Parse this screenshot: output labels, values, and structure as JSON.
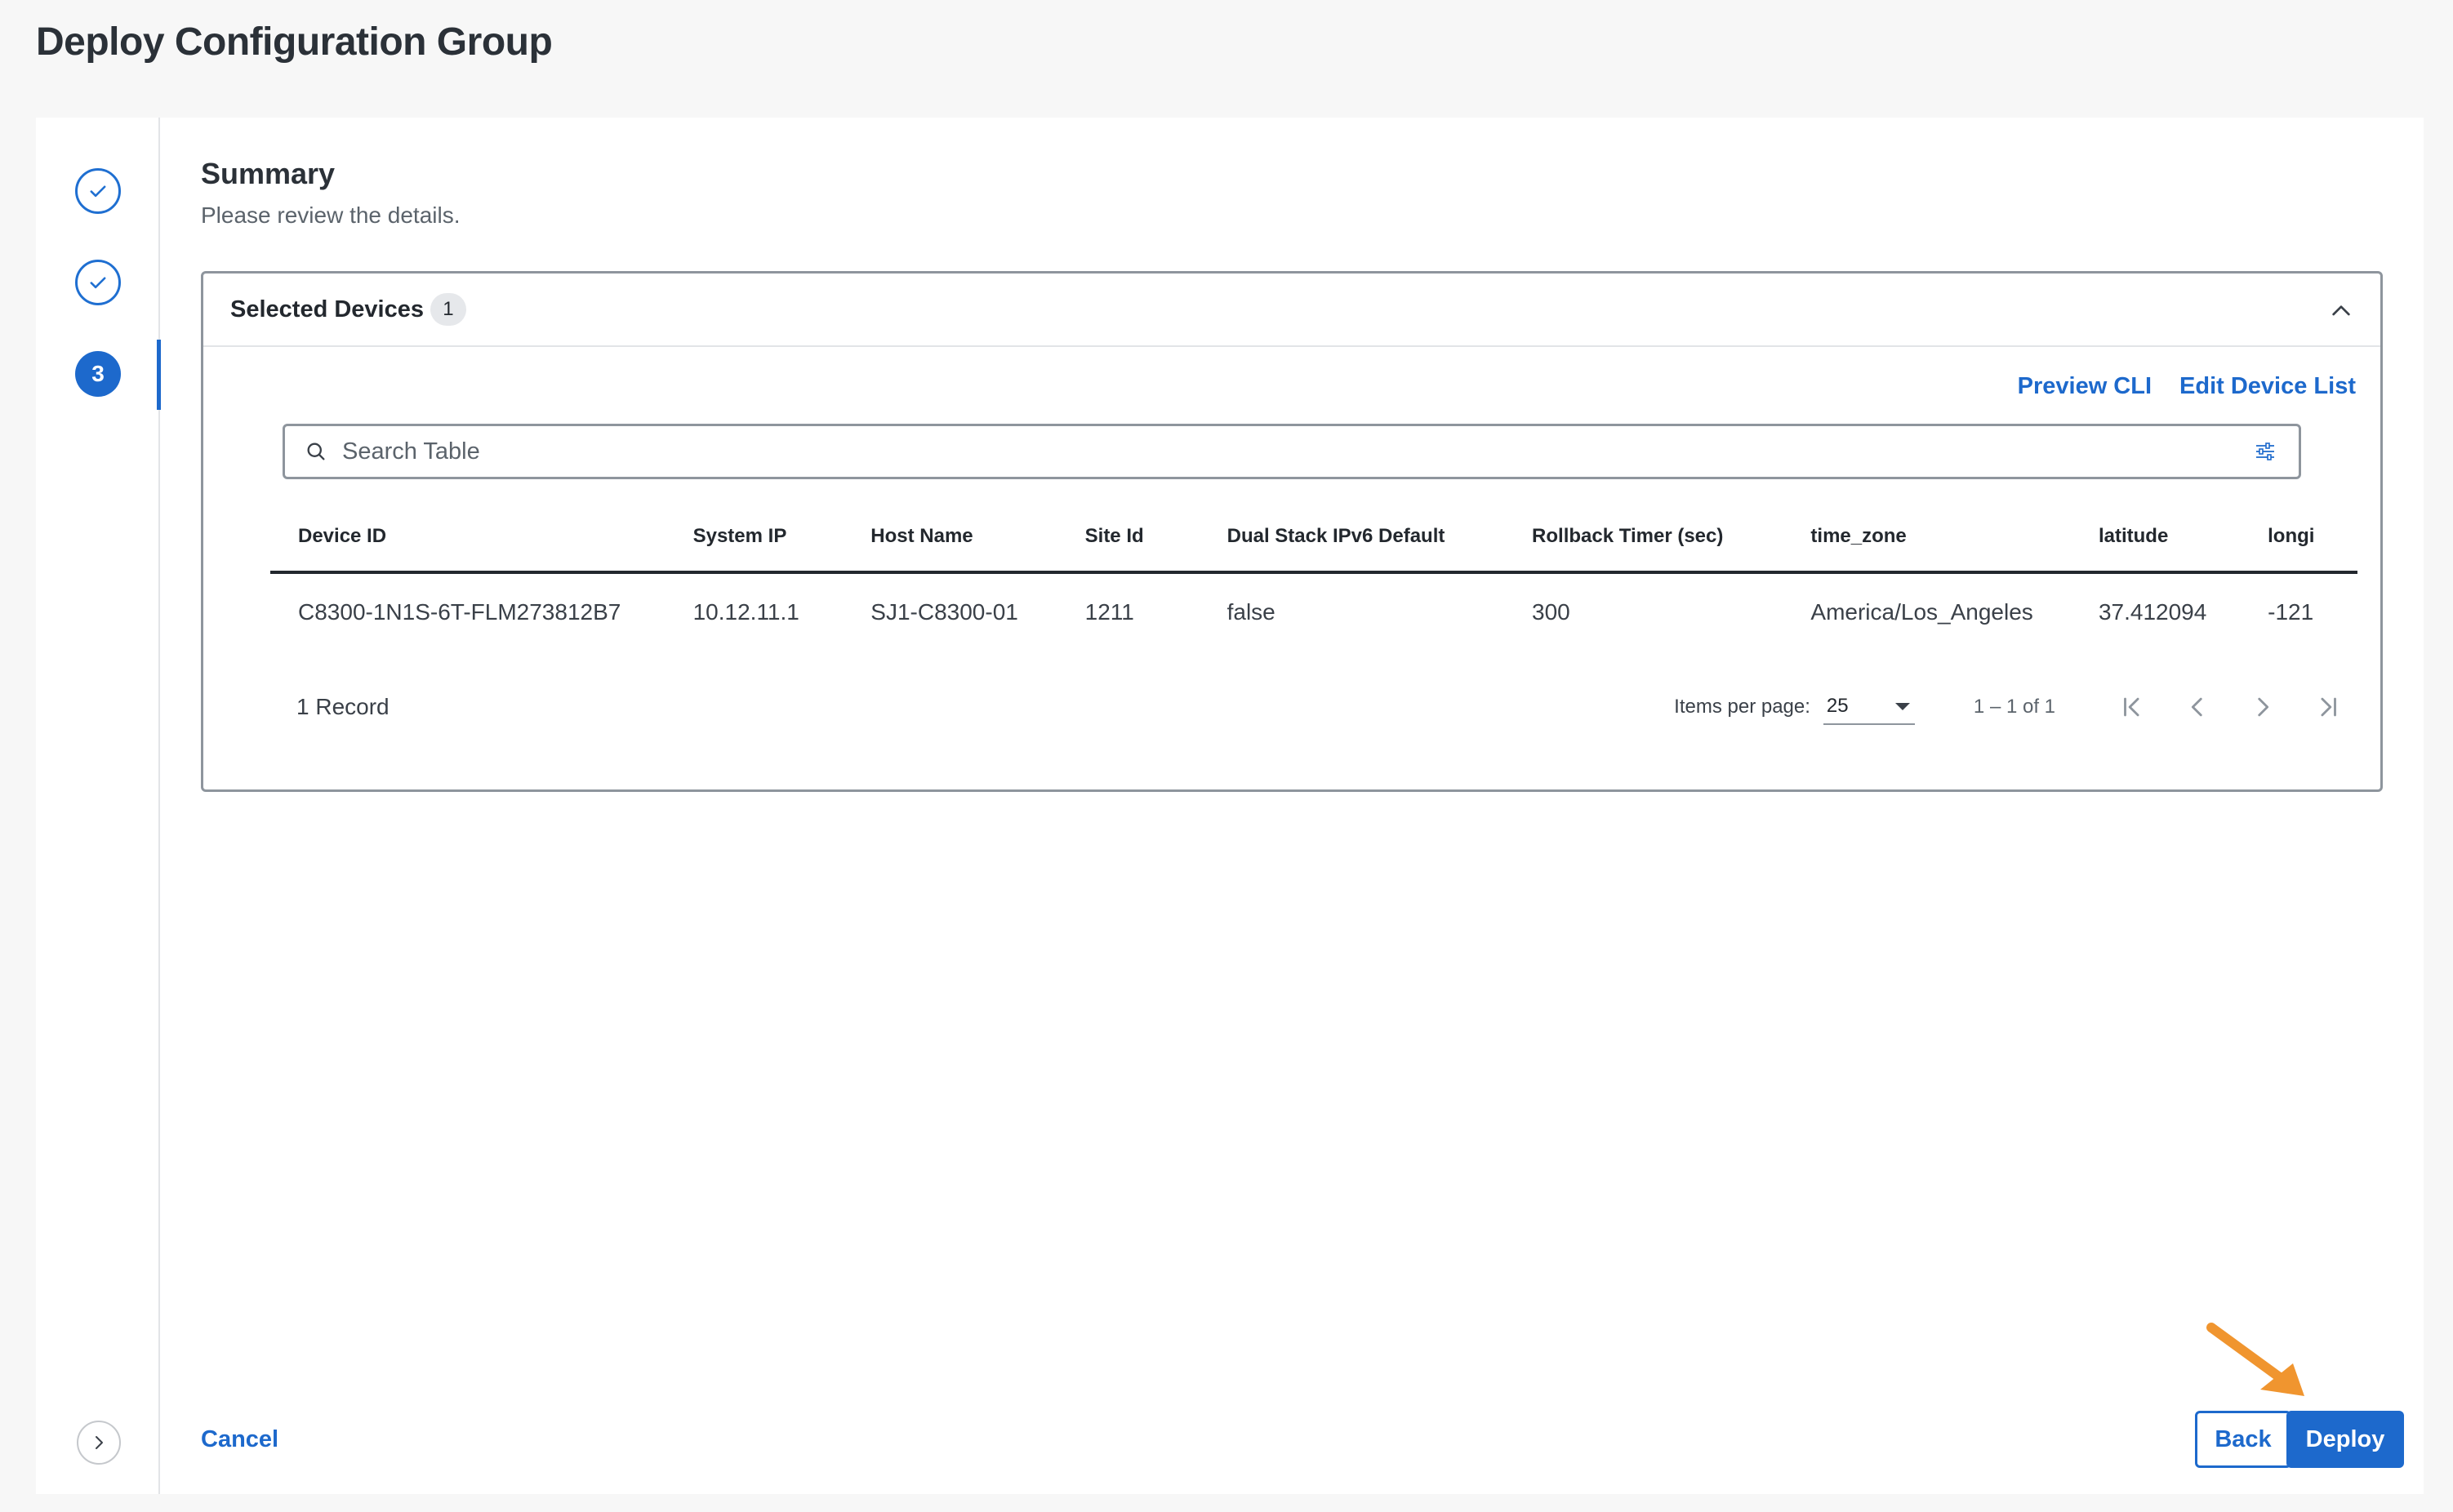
{
  "page": {
    "title": "Deploy Configuration Group"
  },
  "stepper": {
    "steps": [
      {
        "state": "done",
        "icon": "check-icon"
      },
      {
        "state": "done",
        "icon": "check-icon"
      },
      {
        "state": "active",
        "label": "3"
      }
    ],
    "expand_icon": "chevron-right-icon"
  },
  "summary": {
    "title": "Summary",
    "subtitle": "Please review the details."
  },
  "devices_panel": {
    "title": "Selected Devices",
    "count": "1",
    "collapse_icon": "chevron-up-icon",
    "actions": {
      "preview_cli": "Preview CLI",
      "edit_device_list": "Edit Device List"
    },
    "search": {
      "placeholder": "Search Table",
      "value": ""
    },
    "table": {
      "columns": [
        "Device ID",
        "System IP",
        "Host Name",
        "Site Id",
        "Dual Stack IPv6 Default",
        "Rollback Timer (sec)",
        "time_zone",
        "latitude",
        "longi"
      ],
      "rows": [
        [
          "C8300-1N1S-6T-FLM273812B7",
          "10.12.11.1",
          "SJ1-C8300-01",
          "1211",
          "false",
          "300",
          "America/Los_Angeles",
          "37.412094",
          "-121"
        ]
      ]
    },
    "pagination": {
      "record_count": "1 Record",
      "items_per_page_label": "Items per page:",
      "items_per_page": "25",
      "range": "1 – 1 of 1"
    }
  },
  "footer": {
    "cancel": "Cancel",
    "back": "Back",
    "deploy": "Deploy"
  },
  "colors": {
    "accent": "#1d69cc",
    "annotation_arrow": "#f0952f"
  }
}
